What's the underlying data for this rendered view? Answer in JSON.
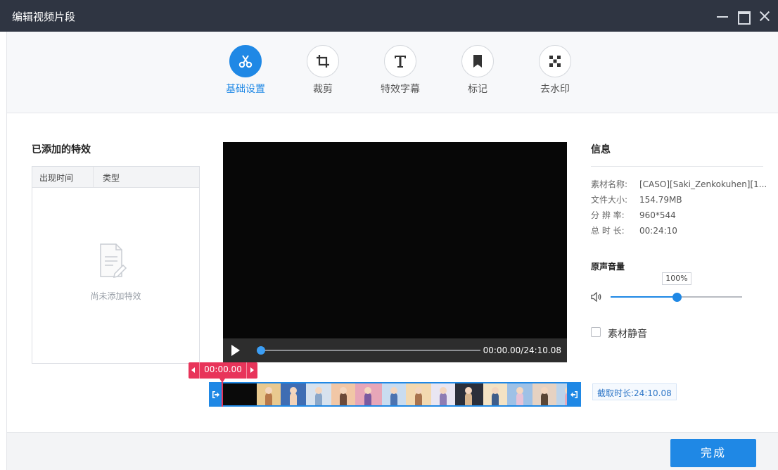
{
  "window": {
    "title": "编辑视频片段"
  },
  "toolbar": {
    "tools": [
      {
        "label": "基础设置",
        "icon": "scissors-icon",
        "active": true
      },
      {
        "label": "裁剪",
        "icon": "crop-icon",
        "active": false
      },
      {
        "label": "特效字幕",
        "icon": "text-icon",
        "active": false
      },
      {
        "label": "标记",
        "icon": "bookmark-icon",
        "active": false
      },
      {
        "label": "去水印",
        "icon": "mosaic-icon",
        "active": false
      }
    ]
  },
  "effects": {
    "title": "已添加的特效",
    "columns": [
      "出现时间",
      "类型"
    ],
    "empty_text": "尚未添加特效"
  },
  "player": {
    "time_display": "00:00.00/24:10.08",
    "progress": 0.0
  },
  "timeline": {
    "marker_time": "00:00.00",
    "cut_duration": "截取时长:24:10.08"
  },
  "info": {
    "title": "信息",
    "rows": [
      {
        "key": "素材名称:",
        "value": "[CASO][Saki_Zenkokuhen][1..."
      },
      {
        "key": "文件大小:",
        "value": "154.79MB"
      },
      {
        "key": "分 辨 率:",
        "value": "960*544"
      },
      {
        "key": "总 时 长:",
        "value": "00:24:10"
      }
    ]
  },
  "volume": {
    "title": "原声音量",
    "value_label": "100%",
    "level": 0.5
  },
  "mute": {
    "label": "素材静音",
    "checked": false
  },
  "footer": {
    "done_label": "完成"
  },
  "colors": {
    "accent": "#1f88e5",
    "marker": "#e8345a",
    "titlebar": "#2f3542"
  }
}
